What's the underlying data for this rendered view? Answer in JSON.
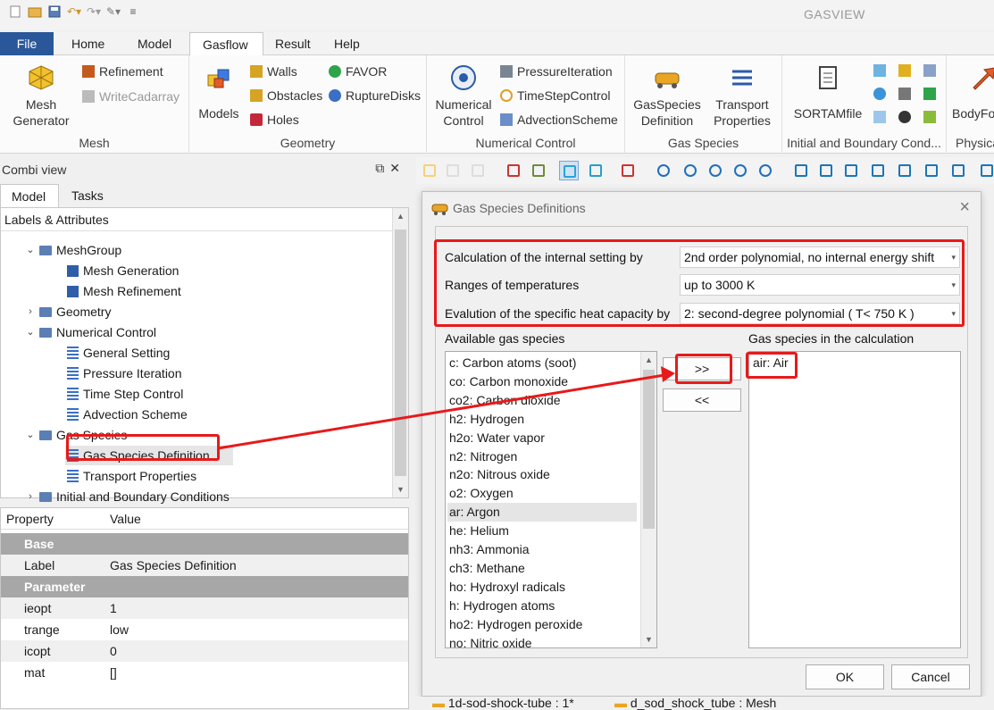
{
  "app": {
    "title": "GASVIEW"
  },
  "quick_access": [
    "new-icon",
    "open-icon",
    "save-icon",
    "undo-icon",
    "redo-icon",
    "tools-icon",
    "customize-icon"
  ],
  "ribbon_tabs": [
    {
      "label": "File"
    },
    {
      "label": "Home"
    },
    {
      "label": "Model"
    },
    {
      "label": "Gasflow"
    },
    {
      "label": "Result"
    },
    {
      "label": "Help"
    }
  ],
  "ribbon": {
    "mesh": {
      "label": "Mesh",
      "mesh_generator": "Mesh\nGenerator",
      "refinement": "Refinement",
      "write_cadarray": "WriteCadarray"
    },
    "geometry": {
      "label": "Geometry",
      "models": "Models",
      "walls": "Walls",
      "obstacles": "Obstacles",
      "holes": "Holes",
      "favor": "FAVOR",
      "rupture_disks": "RuptureDisks"
    },
    "numerical": {
      "label": "Numerical Control",
      "numerical_control_1": "Numerical",
      "numerical_control_2": "Control",
      "pressure_iteration": "PressureIteration",
      "time_step_control": "TimeStepControl",
      "advection_scheme": "AdvectionScheme"
    },
    "gas_species": {
      "label": "Gas Species",
      "def_1": "GasSpecies",
      "def_2": "Definition",
      "tp_1": "Transport",
      "tp_2": "Properties"
    },
    "initial": {
      "label": "Initial and Boundary Cond...",
      "sortam": "SORTAMfile"
    },
    "physical": {
      "label": "Physica",
      "body_force": "BodyFo"
    }
  },
  "combi": {
    "title": "Combi view",
    "tabs": [
      "Model",
      "Tasks"
    ],
    "tree_header": "Labels & Attributes",
    "tree": [
      {
        "label": "MeshGroup",
        "level": 1,
        "chev": "⌄",
        "icon": "folder"
      },
      {
        "label": "Mesh Generation",
        "level": 2,
        "icon": "cube"
      },
      {
        "label": "Mesh Refinement",
        "level": 2,
        "icon": "cube"
      },
      {
        "label": "Geometry",
        "level": 1,
        "chev": "›",
        "icon": "folder"
      },
      {
        "label": "Numerical Control",
        "level": 1,
        "chev": "⌄",
        "icon": "folder"
      },
      {
        "label": "General Setting",
        "level": 2,
        "icon": "list"
      },
      {
        "label": "Pressure Iteration",
        "level": 2,
        "icon": "list"
      },
      {
        "label": "Time Step Control",
        "level": 2,
        "icon": "list"
      },
      {
        "label": "Advection Scheme",
        "level": 2,
        "icon": "list"
      },
      {
        "label": "Gas Species",
        "level": 1,
        "chev": "⌄",
        "icon": "folder"
      },
      {
        "label": "Gas Species Definition",
        "level": 2,
        "icon": "list",
        "selected": true
      },
      {
        "label": "Transport Properties",
        "level": 2,
        "icon": "list"
      },
      {
        "label": "Initial and Boundary Conditions",
        "level": 1,
        "chev": "›",
        "icon": "folder"
      }
    ],
    "props_header": {
      "property": "Property",
      "value": "Value"
    },
    "props": [
      {
        "group": "Base"
      },
      {
        "k": "Label",
        "v": "Gas Species Definition"
      },
      {
        "group": "Parameter"
      },
      {
        "k": "ieopt",
        "v": "1"
      },
      {
        "k": "trange",
        "v": "low"
      },
      {
        "k": "icopt",
        "v": "0"
      },
      {
        "k": "mat",
        "v": "[]"
      }
    ]
  },
  "dialog": {
    "title": "Gas Species Definitions",
    "calc_label": "Calculation of the internal setting by",
    "calc_value": "2nd order polynomial, no internal energy shift",
    "range_label": "Ranges of temperatures",
    "range_value": "up to 3000 K",
    "heat_label": "Evalution of the specific heat capacity by",
    "heat_value": "2: second-degree polynomial ( T< 750 K )",
    "available_label": "Available gas species",
    "selected_label": "Gas species in the calculation",
    "available": [
      "c: Carbon atoms (soot)",
      "co: Carbon monoxide",
      "co2: Carbon dioxide",
      "h2: Hydrogen",
      "h2o: Water vapor",
      "n2: Nitrogen",
      "n2o: Nitrous oxide",
      "o2: Oxygen",
      "ar: Argon",
      "he: Helium",
      "nh3: Ammonia",
      "ch3: Methane",
      "ho: Hydroxyl radicals",
      "h: Hydrogen atoms",
      "ho2: Hydrogen peroxide",
      "no: Nitric oxide"
    ],
    "available_selected": "ar: Argon",
    "selected": [
      "air: Air"
    ],
    "add_label": ">>",
    "remove_label": "<<",
    "ok_label": "OK",
    "cancel_label": "Cancel"
  },
  "bottom_tabs": [
    "1d-sod-shock-tube : 1*",
    "d_sod_shock_tube : Mesh"
  ],
  "colors": {
    "accent": "#2a579a",
    "highlight": "#e8191a",
    "group_header": "#a7a7a7"
  }
}
